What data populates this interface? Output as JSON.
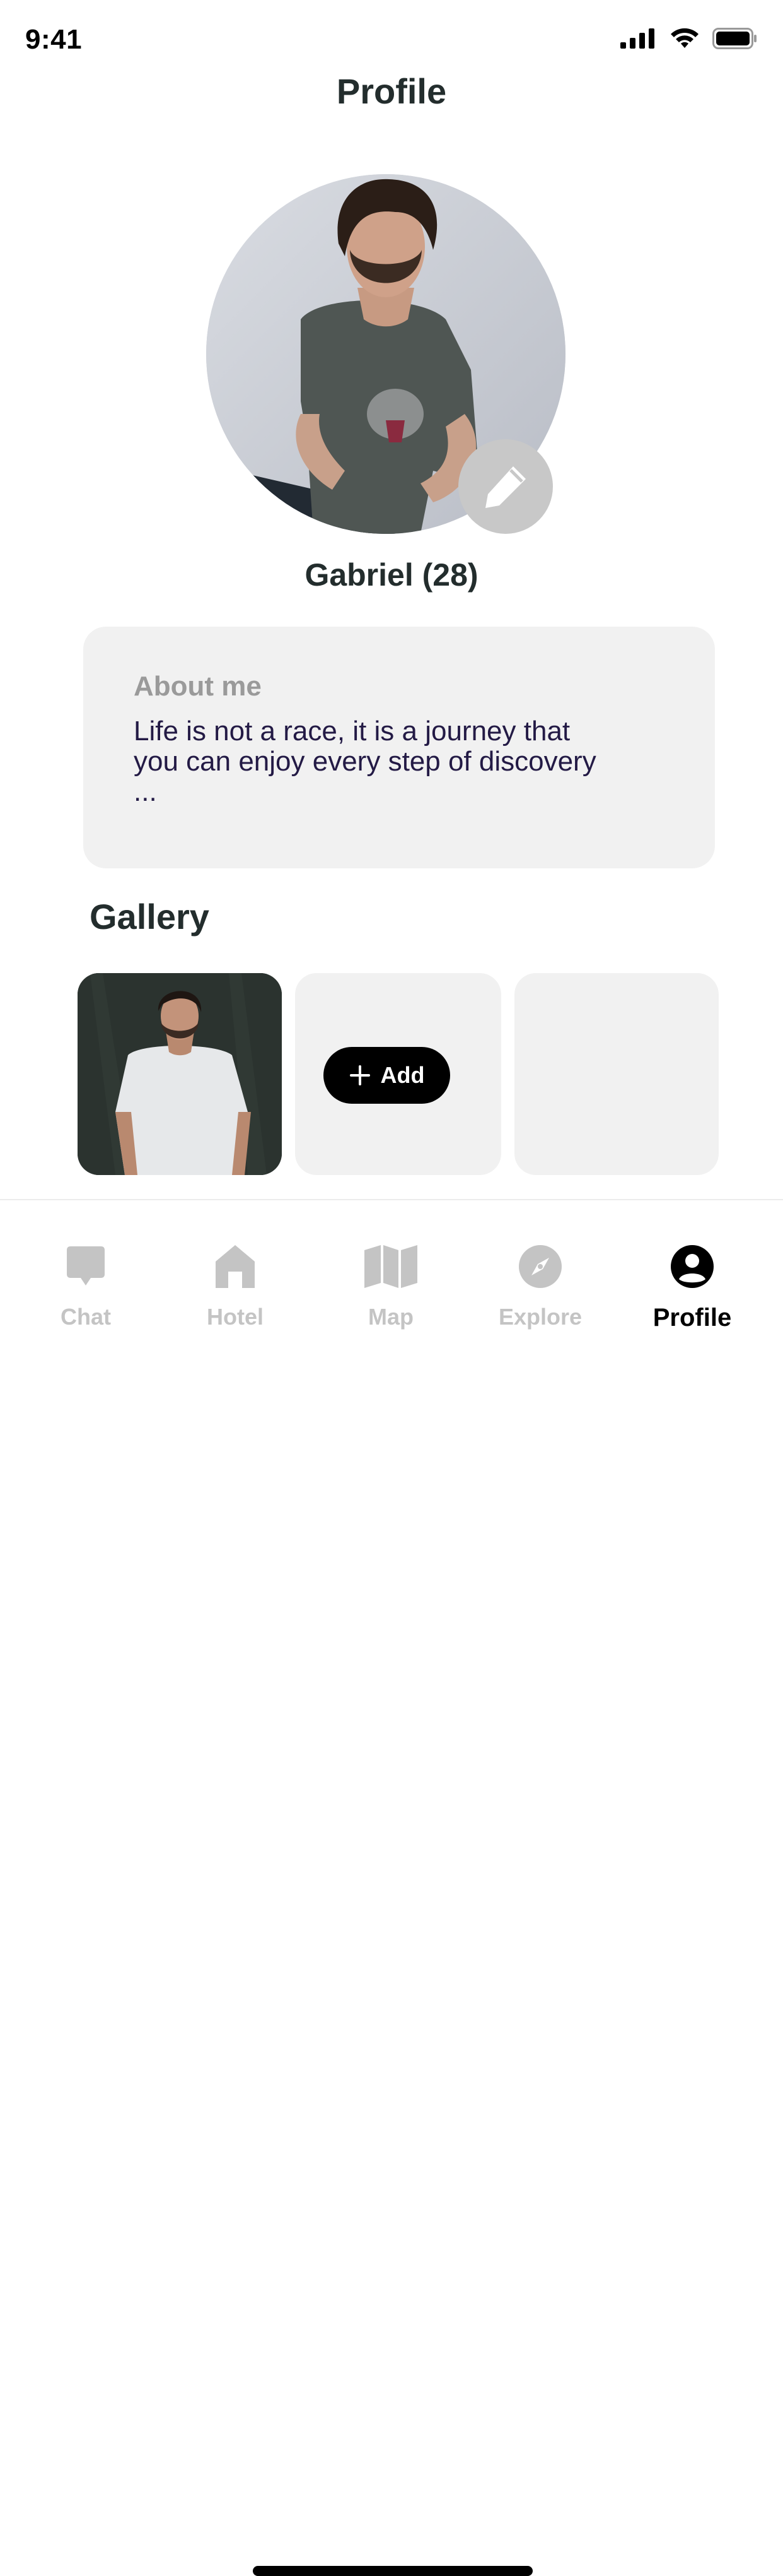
{
  "status_bar": {
    "time": "9:41"
  },
  "header": {
    "title": "Profile"
  },
  "profile": {
    "name": "Gabriel (28)",
    "about_title": "About me",
    "about_text": "Life is not a race, it is a journey that you can enjoy every step of discovery ..."
  },
  "gallery": {
    "title": "Gallery",
    "add_label": "Add"
  },
  "tabs": [
    {
      "label": "Chat",
      "icon": "chat-icon",
      "active": false
    },
    {
      "label": "Hotel",
      "icon": "hotel-icon",
      "active": false
    },
    {
      "label": "Map",
      "icon": "map-icon",
      "active": false
    },
    {
      "label": "Explore",
      "icon": "compass-icon",
      "active": false
    },
    {
      "label": "Profile",
      "icon": "profile-icon",
      "active": true
    }
  ],
  "colors": {
    "background": "#ffffff",
    "card": "#f1f1f1",
    "active_tab": "#000000",
    "inactive_tab": "#c4c4c4",
    "edit_button": "#c8c8c8"
  }
}
